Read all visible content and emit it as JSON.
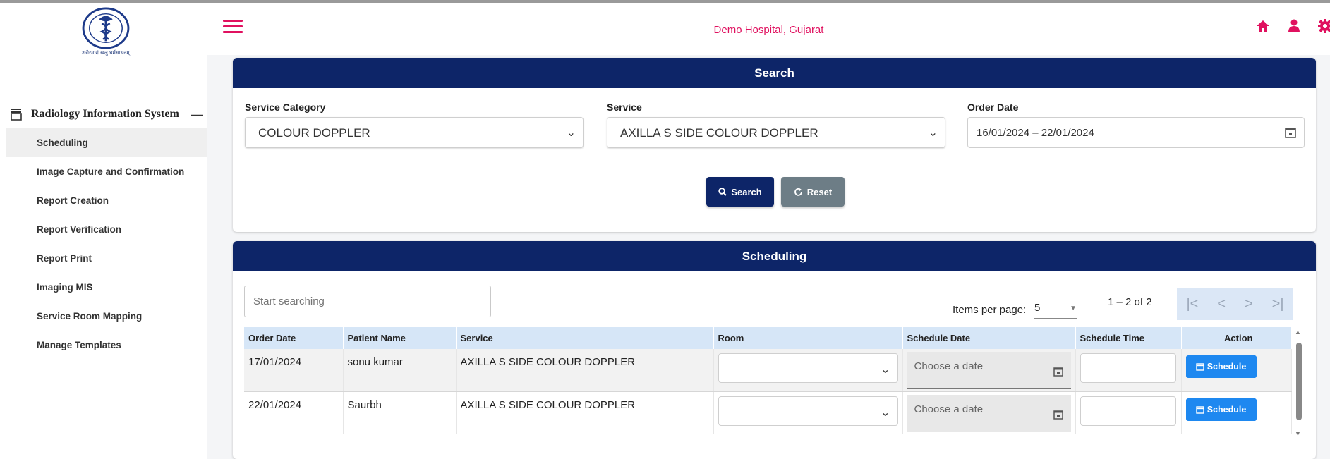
{
  "colors": {
    "navy": "#0d2568",
    "brand_pink": "#e0115f",
    "schedule_blue": "#1e88f0"
  },
  "header": {
    "title": "Demo Hospital, Gujarat",
    "icons": [
      "menu-icon",
      "home-icon",
      "user-icon",
      "gear-icon"
    ]
  },
  "sidebar": {
    "logo_caption": "शरीरमाद्यं खलु धर्मसाधनम्",
    "module_title": "Radiology Information System",
    "collapse_symbol": "—",
    "items": [
      {
        "label": "Scheduling",
        "active": true
      },
      {
        "label": "Image Capture and Confirmation"
      },
      {
        "label": "Report Creation"
      },
      {
        "label": "Report Verification"
      },
      {
        "label": "Report Print"
      },
      {
        "label": "Imaging MIS"
      },
      {
        "label": "Service Room Mapping"
      },
      {
        "label": "Manage Templates"
      }
    ]
  },
  "search": {
    "title": "Search",
    "service_category": {
      "label": "Service Category",
      "value": "COLOUR DOPPLER"
    },
    "service": {
      "label": "Service",
      "value": "AXILLA S SIDE COLOUR DOPPLER"
    },
    "order_date": {
      "label": "Order Date",
      "value": "16/01/2024  – 22/01/2024"
    },
    "search_button": "Search",
    "reset_button": "Reset"
  },
  "scheduling": {
    "title": "Scheduling",
    "filter_placeholder": "Start searching",
    "items_per_page_label": "Items per page:",
    "items_per_page": "5",
    "range_label": "1 – 2 of 2",
    "columns": [
      "Order Date",
      "Patient Name",
      "Service",
      "Room",
      "Schedule Date",
      "Schedule Time",
      "Action"
    ],
    "rows": [
      {
        "order_date": "17/01/2024",
        "patient": "sonu kumar",
        "service": "AXILLA S SIDE COLOUR DOPPLER",
        "date_placeholder": "Choose a date",
        "action": "Schedule"
      },
      {
        "order_date": "22/01/2024",
        "patient": "Saurbh",
        "service": "AXILLA S SIDE COLOUR DOPPLER",
        "date_placeholder": "Choose a date",
        "action": "Schedule"
      }
    ]
  }
}
